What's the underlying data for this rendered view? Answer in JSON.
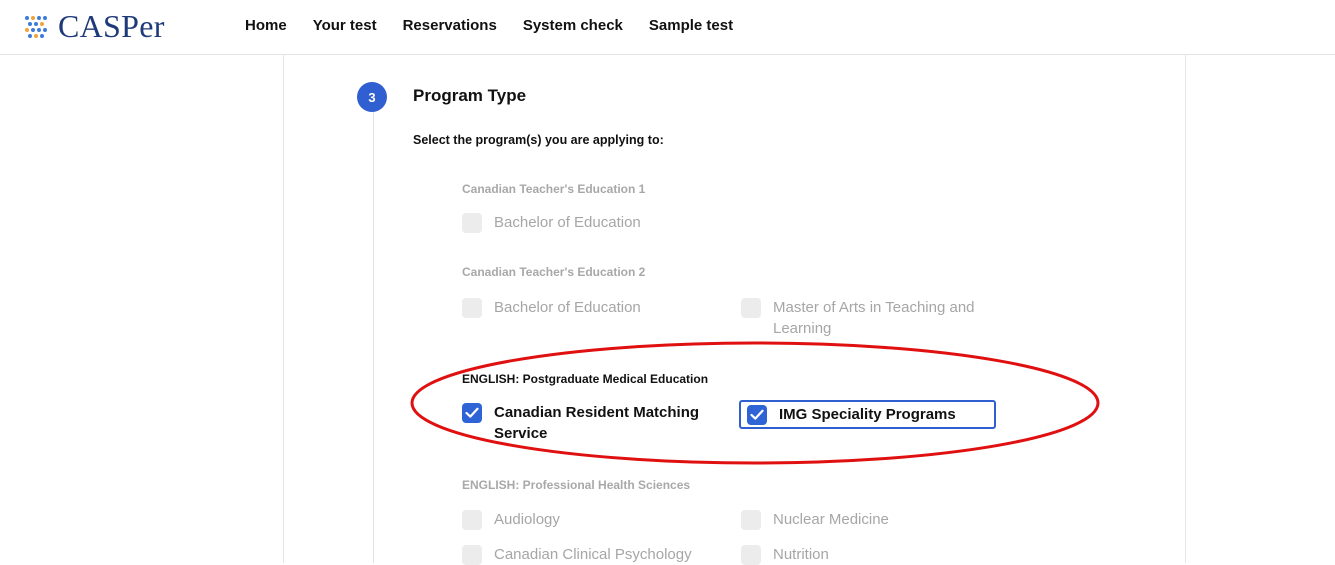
{
  "brand": {
    "name": "CASPer"
  },
  "nav": [
    "Home",
    "Your test",
    "Reservations",
    "System check",
    "Sample test"
  ],
  "step": {
    "number": "3",
    "title": "Program Type"
  },
  "instruction": "Select the program(s) you are applying to:",
  "groups": [
    {
      "label": "Canadian Teacher's Education 1",
      "options": [
        {
          "label": "Bachelor of Education",
          "checked": false
        }
      ]
    },
    {
      "label": "Canadian Teacher's Education 2",
      "options": [
        {
          "label": "Bachelor of Education",
          "checked": false
        },
        {
          "label": "Master of Arts in Teaching and Learning",
          "checked": false
        }
      ]
    },
    {
      "label": "ENGLISH: Postgraduate Medical Education",
      "options": [
        {
          "label": "Canadian Resident Matching Service",
          "checked": true
        },
        {
          "label": "IMG Speciality Programs",
          "checked": true
        }
      ]
    },
    {
      "label": "ENGLISH: Professional Health Sciences",
      "options": [
        {
          "label": "Audiology",
          "checked": false
        },
        {
          "label": "Nuclear Medicine",
          "checked": false
        },
        {
          "label": "Canadian Clinical Psychology",
          "checked": false
        },
        {
          "label": "Nutrition",
          "checked": false
        }
      ]
    }
  ],
  "colors": {
    "accent": "#2f5fd0",
    "logo": "#1f3a7a",
    "disabled_text": "#a6a6a6",
    "annotation": "#e01010"
  }
}
